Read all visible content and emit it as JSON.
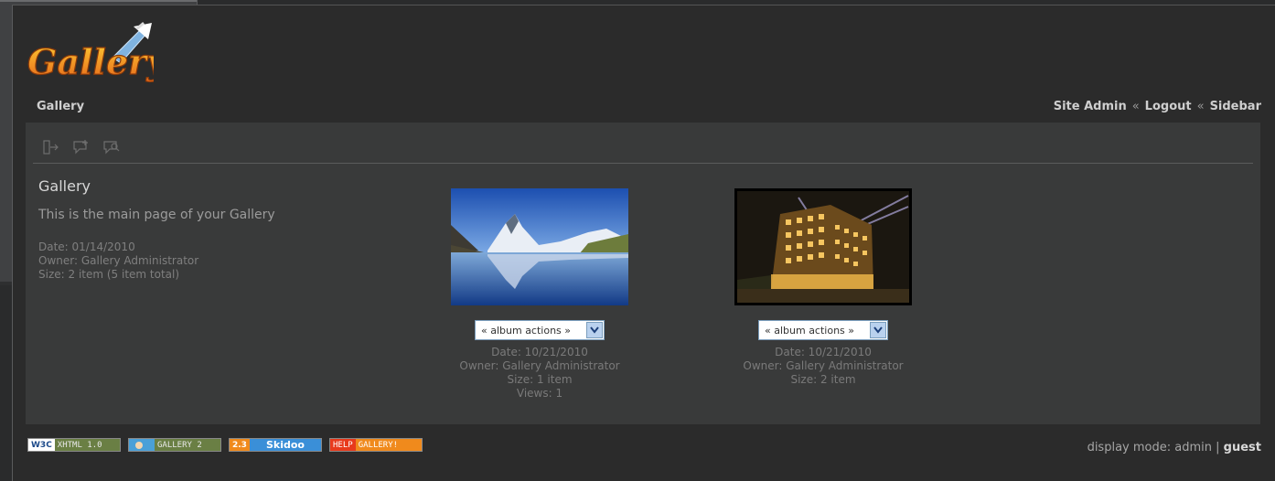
{
  "logo": {
    "text": "Gallery",
    "icon": "gallery-logo"
  },
  "header": {
    "breadcrumb": "Gallery",
    "links": {
      "site_admin": "Site Admin",
      "logout": "Logout",
      "sidebar": "Sidebar",
      "separator": "«"
    }
  },
  "toolbar": {
    "icons": [
      "exit-icon",
      "comment-add-icon",
      "comment-view-icon"
    ]
  },
  "album": {
    "title": "Gallery",
    "description": "This is the main page of your Gallery",
    "date": "Date: 01/14/2010",
    "owner": "Owner: Gallery Administrator",
    "size": "Size: 2 item (5 item total)"
  },
  "items": [
    {
      "actions_label": "« album actions »",
      "date": "Date: 10/21/2010",
      "owner": "Owner: Gallery Administrator",
      "size": "Size: 1 item",
      "views": "Views: 1"
    },
    {
      "actions_label": "« album actions »",
      "date": "Date: 10/21/2010",
      "owner": "Owner: Gallery Administrator",
      "size": "Size: 2 item"
    }
  ],
  "badges": {
    "w3c": {
      "left": "W3C",
      "right": "XHTML 1.0"
    },
    "gallery2": {
      "right": "GALLERY 2"
    },
    "skidoo": {
      "left": "2.3",
      "right": "Skidoo"
    },
    "help": {
      "left": "HELP",
      "right": "GALLERY!"
    }
  },
  "footer": {
    "prefix": "display mode:",
    "admin": "admin",
    "sep": "|",
    "guest": "guest"
  },
  "colors": {
    "background": "#2b2b2b",
    "panel": "#393a3a",
    "text": "#c9c9c9"
  }
}
